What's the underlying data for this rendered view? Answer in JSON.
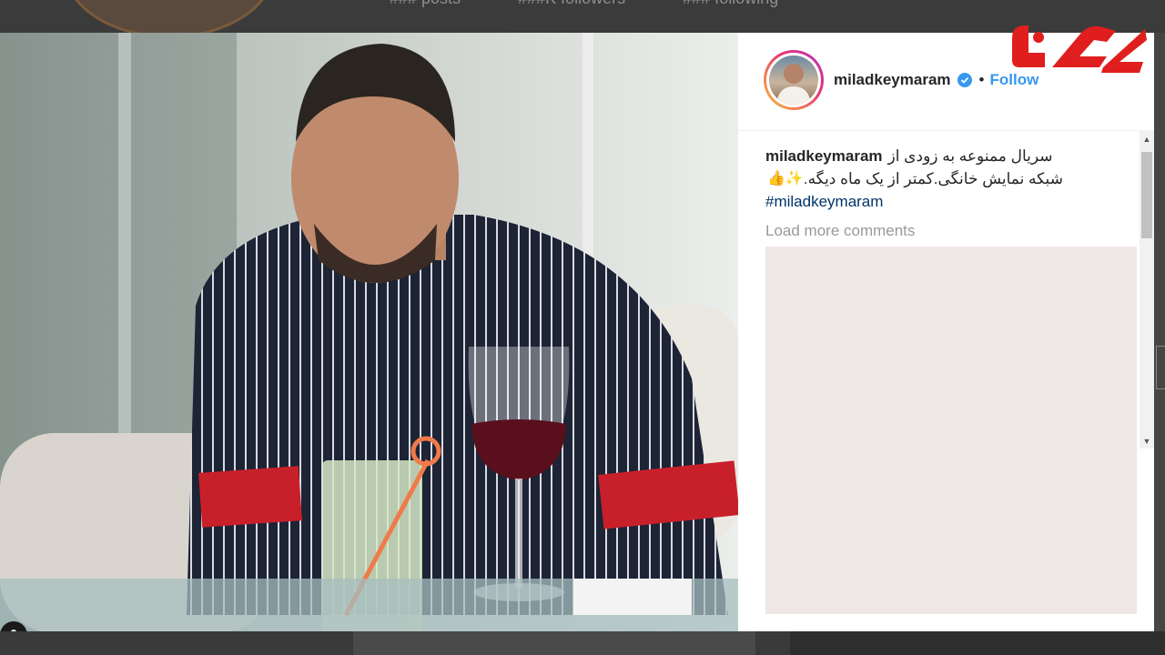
{
  "background_profile": {
    "stats": [
      "### posts",
      "###K followers",
      "### following"
    ]
  },
  "post": {
    "username": "miladkeymaram",
    "verified": true,
    "separator": "•",
    "follow_label": "Follow",
    "caption_line1": "سریال ممنوعه به زودی از",
    "caption_line2": "شبکه نمایش خانگی.کمتر از یک ماه دیگه.",
    "caption_emojis": "✨👍",
    "hashtag": "#miladkeymaram",
    "load_more_label": "Load more comments"
  },
  "scrollbar": {
    "up_arrow": "▲",
    "down_arrow": "▼"
  },
  "watermark": {
    "name": "rokna-logo",
    "color": "#e01e1e"
  },
  "colors": {
    "accent": "#3897f0",
    "hashtag": "#003569",
    "muted": "#999999"
  },
  "icons": [
    "verified-badge-icon",
    "user-tag-icon",
    "scroll-up-icon",
    "scroll-down-icon"
  ]
}
